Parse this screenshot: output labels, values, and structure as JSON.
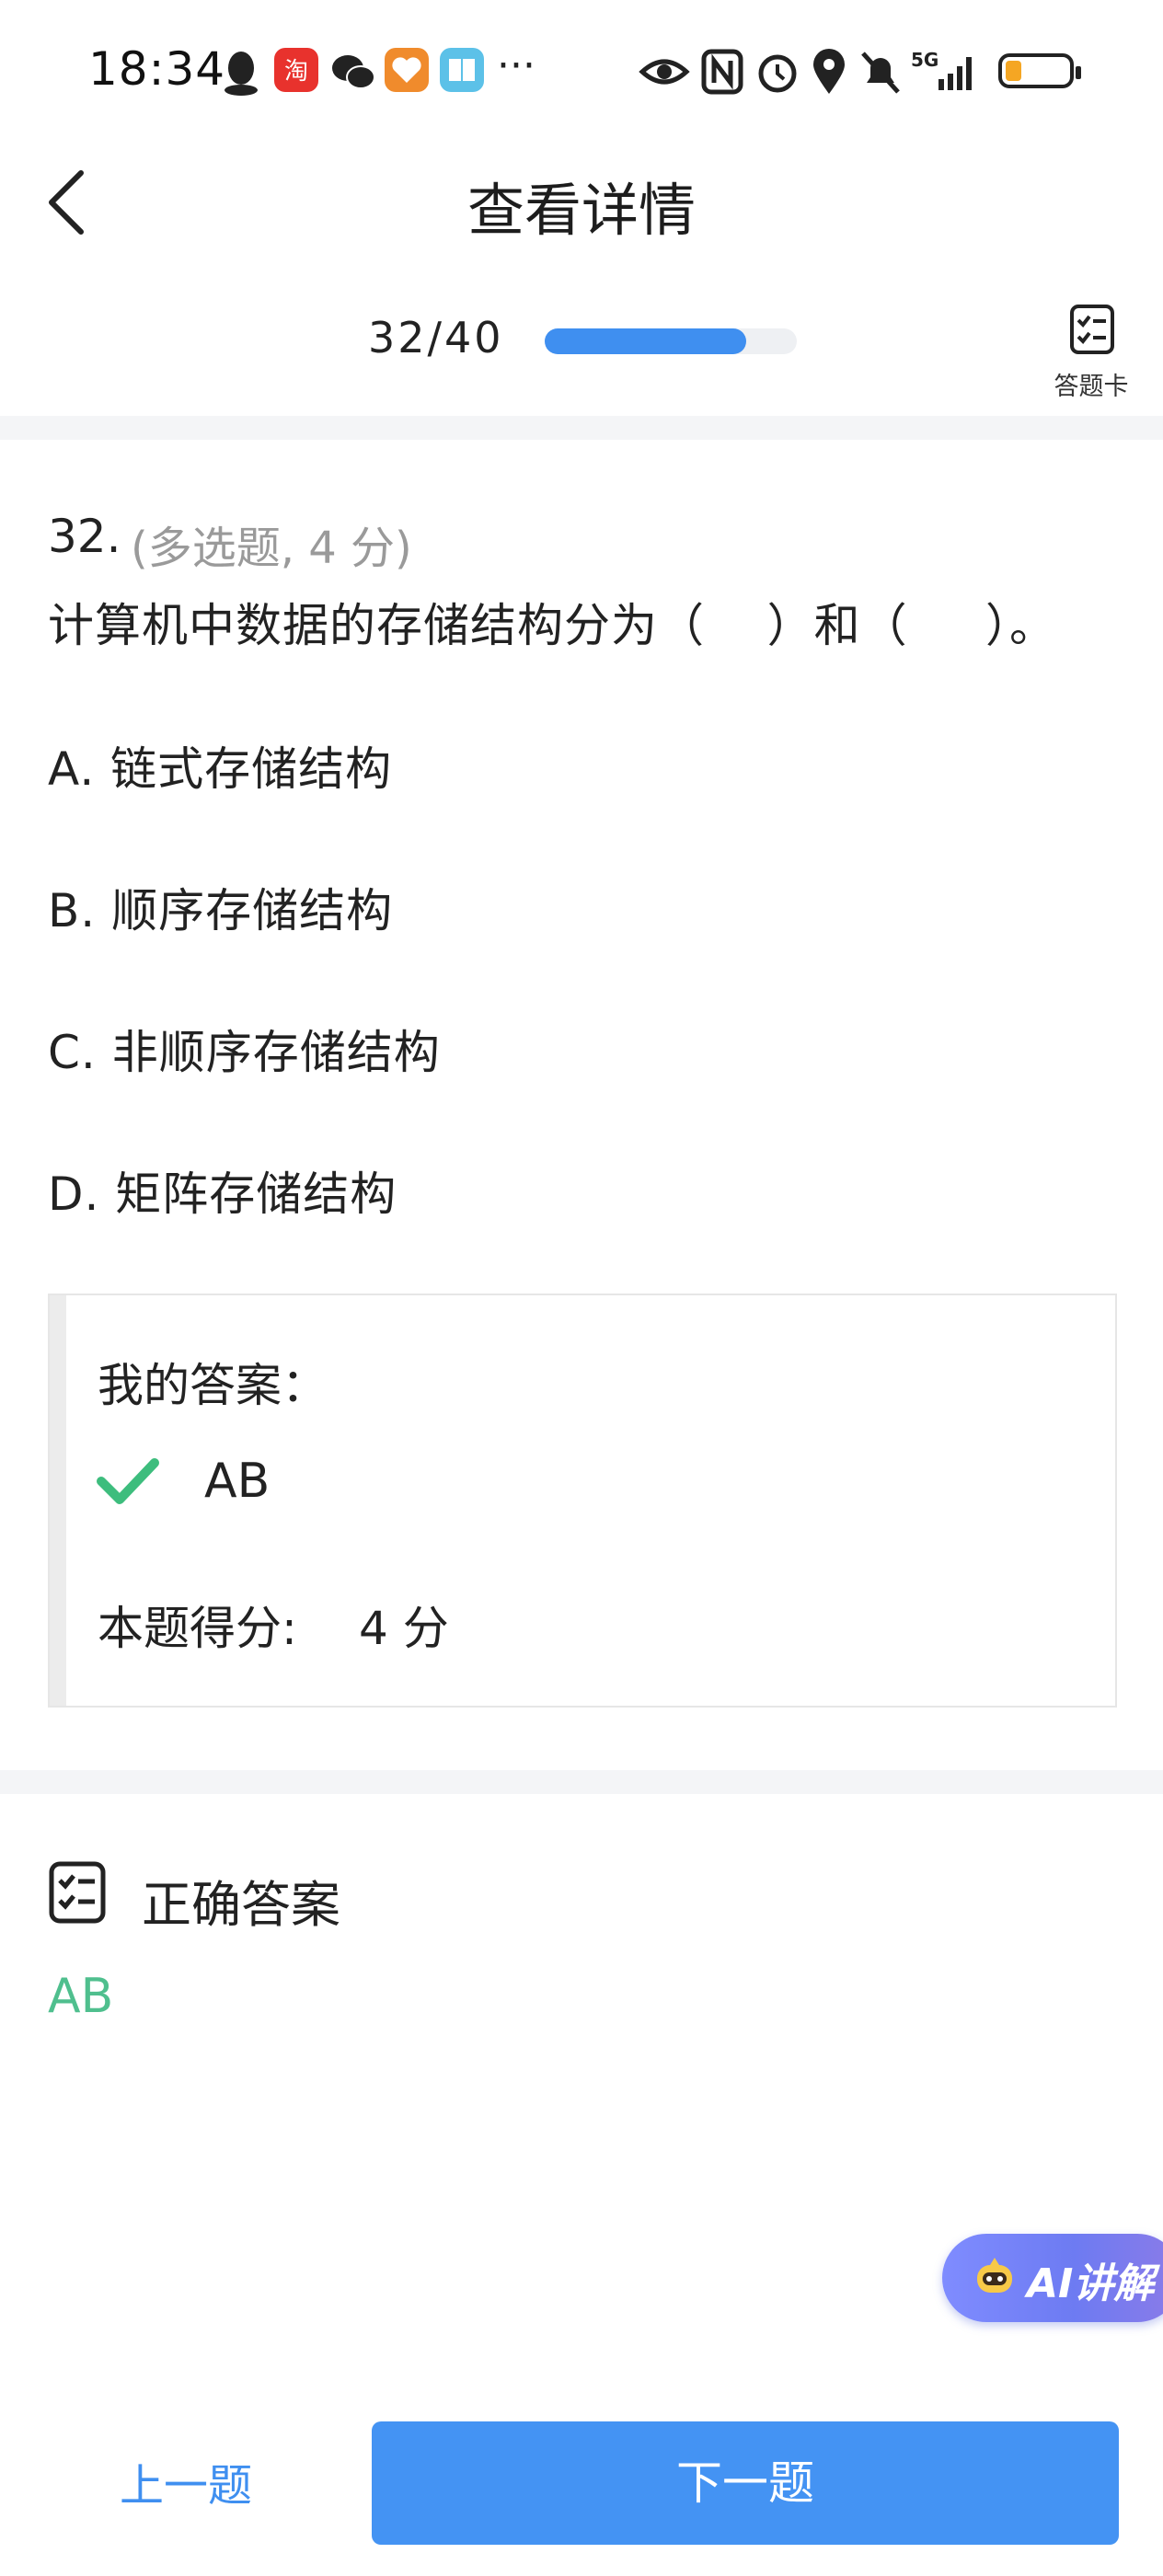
{
  "status_bar": {
    "time": "18:34",
    "more": "···",
    "battery_level": 0.25,
    "signal": "5G"
  },
  "header": {
    "title": "查看详情",
    "progress_text": "32/40",
    "progress": 0.8,
    "answer_card_label": "答题卡"
  },
  "question": {
    "number": "32.",
    "meta": "(多选题, 4 分)",
    "text": "计算机中数据的存储结构分为（    ）和（     ）。",
    "options": [
      "A. 链式存储结构",
      "B. 顺序存储结构",
      "C. 非顺序存储结构",
      "D. 矩阵存储结构"
    ]
  },
  "my_answer": {
    "label": "我的答案：",
    "value": "AB",
    "score_label": "本题得分:",
    "score_value": "4 分"
  },
  "correct_answer": {
    "title": "正确答案",
    "value": "AB"
  },
  "ai_button": {
    "label": "AI讲解"
  },
  "footer": {
    "prev_label": "上一题",
    "next_label": "下一题"
  },
  "colors": {
    "accent": "#4493f3",
    "correct": "#4fbf8e",
    "check": "#3dbd7d"
  }
}
